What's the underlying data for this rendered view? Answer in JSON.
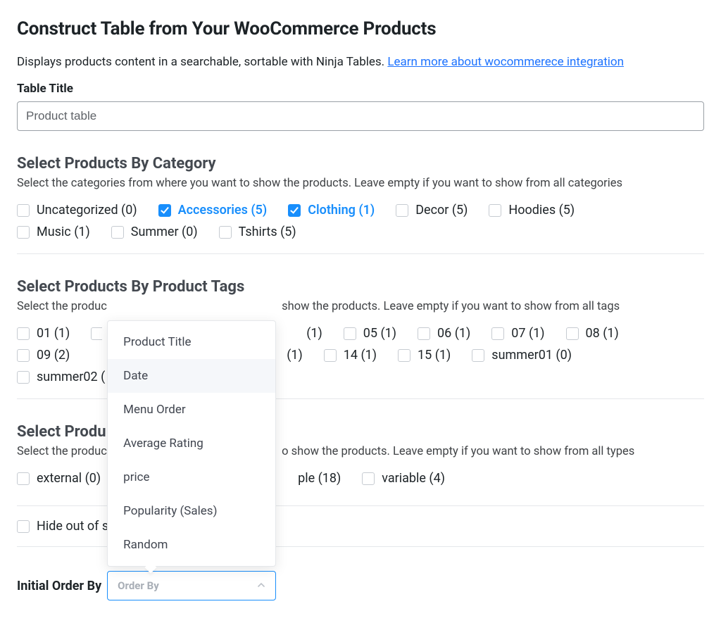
{
  "header": {
    "title": "Construct Table from Your WooCommerce Products",
    "intro": "Displays products content in a searchable, sortable with Ninja Tables. ",
    "learn_more": "Learn more about wocommerece integration"
  },
  "title_field": {
    "label": "Table Title",
    "value": "Product table"
  },
  "category": {
    "title": "Select Products By Category",
    "help": "Select the categories from where you want to show the products. Leave empty if you want to show from all categories",
    "items": [
      {
        "label": "Uncategorized (0)",
        "checked": false
      },
      {
        "label": "Accessories (5)",
        "checked": true
      },
      {
        "label": "Clothing (1)",
        "checked": true
      },
      {
        "label": "Decor (5)",
        "checked": false
      },
      {
        "label": "Hoodies (5)",
        "checked": false
      },
      {
        "label": "Music (1)",
        "checked": false
      },
      {
        "label": "Summer (0)",
        "checked": false
      },
      {
        "label": "Tshirts (5)",
        "checked": false
      }
    ]
  },
  "tags": {
    "title": "Select Products By Product Tags",
    "help_prefix": "Select the produc",
    "help_suffix": "show the products. Leave empty if you want to show from all tags",
    "items": [
      {
        "label": "01 (1)"
      },
      {
        "label": ""
      },
      {
        "label": "(1)"
      },
      {
        "label": "05 (1)"
      },
      {
        "label": "06 (1)"
      },
      {
        "label": "07 (1)"
      },
      {
        "label": "08 (1)"
      },
      {
        "label": "09 (2)"
      },
      {
        "label_suffix": "(1)"
      },
      {
        "label": "14 (1)"
      },
      {
        "label": "15 (1)"
      },
      {
        "label": "summer01 (0)"
      },
      {
        "label": "summer02 ("
      }
    ]
  },
  "types": {
    "title": "Select Produ",
    "help_prefix": "Select the produc",
    "help_suffix": "o show the products. Leave empty if you want to show from all types",
    "items": [
      {
        "label": "external (0)"
      },
      {
        "label_suffix": "ple (18)"
      },
      {
        "label": "variable (4)"
      }
    ]
  },
  "hide_out": {
    "label": "Hide out of s"
  },
  "orderby": {
    "label": "Initial Order By",
    "placeholder": "Order By",
    "options": [
      {
        "label": "Product Title",
        "highlight": false
      },
      {
        "label": "Date",
        "highlight": true
      },
      {
        "label": "Menu Order",
        "highlight": false
      },
      {
        "label": "Average Rating",
        "highlight": false
      },
      {
        "label": "price",
        "highlight": false
      },
      {
        "label": "Popularity (Sales)",
        "highlight": false
      },
      {
        "label": "Random",
        "highlight": false
      }
    ]
  }
}
